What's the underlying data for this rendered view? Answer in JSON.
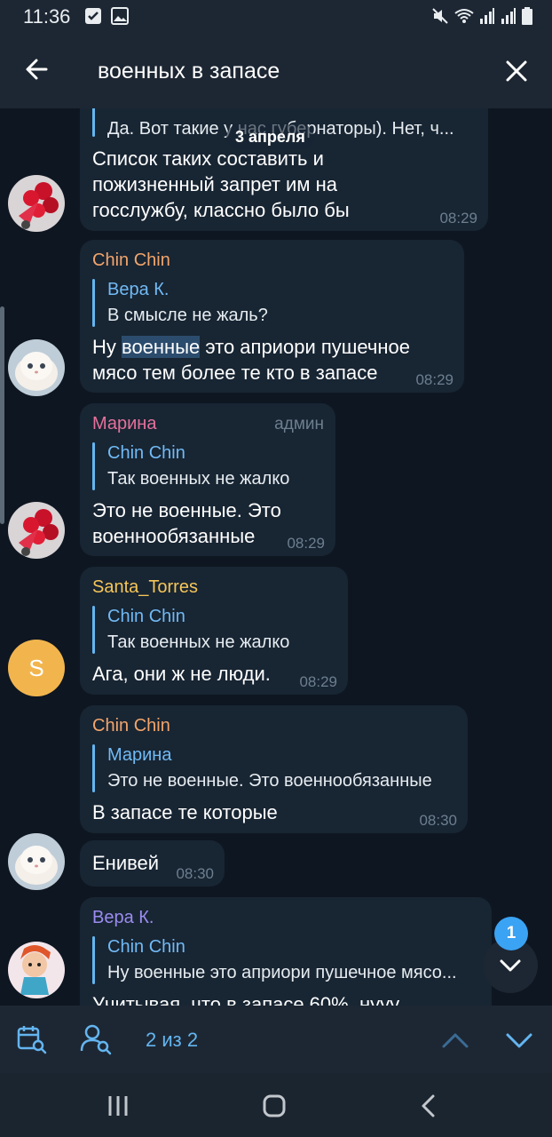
{
  "status": {
    "time": "11:36"
  },
  "header": {
    "search_query": "военных в запасе"
  },
  "date_pill": "3 апреля",
  "messages": [
    {
      "reply_text": "Да. Вот такие у нас губернаторы). Нет, ч...",
      "text_lines": [
        "Список таких составить и",
        "пожизненный запрет им на",
        "госслужбу, классно было бы"
      ],
      "time": "08:29"
    },
    {
      "sender": "Chin Chin",
      "reply_name": "Вера К.",
      "reply_text": "В смысле не жаль?",
      "text_pre": "Ну ",
      "text_highlight": "военные",
      "text_post": " это априори пушечное",
      "text_line2": "мясо тем более те кто в запасе",
      "time": "08:29"
    },
    {
      "sender": "Марина",
      "role": "админ",
      "reply_name": "Chin Chin",
      "reply_text": "Так военных не жалко",
      "text_lines": [
        "Это не военные. Это",
        "военнообязанные"
      ],
      "time": "08:29"
    },
    {
      "sender": "Santa_Torres",
      "reply_name": "Chin Chin",
      "reply_text": "Так военных не жалко",
      "text_lines": [
        "Ага, они ж не люди."
      ],
      "time": "08:29",
      "avatar_letter": "S"
    },
    {
      "sender": "Chin Chin",
      "reply_name": "Марина",
      "reply_text": "Это не военные. Это военнообязанные",
      "text_lines": [
        "В запасе те которые"
      ],
      "time": "08:30"
    },
    {
      "text_lines": [
        "Енивей"
      ],
      "time": "08:30"
    },
    {
      "sender": "Вера К.",
      "reply_name": "Chin Chin",
      "reply_text": "Ну военные это априори пушечное мясо...",
      "text_lines": [
        "Учитывая, что в запасе 60%, нууу"
      ]
    }
  ],
  "scroll_badge": "1",
  "bottom": {
    "counter": "2 из 2"
  },
  "colors": {
    "chin_chin": "#f2a56b",
    "marina": "#e5719c",
    "santa": "#f6c658",
    "vera": "#9b8cf0",
    "accent": "#64b5f0"
  },
  "icons": [
    "back-arrow-icon",
    "close-icon",
    "calendar-search-icon",
    "user-search-icon",
    "chevron-up-icon",
    "chevron-down-icon"
  ]
}
